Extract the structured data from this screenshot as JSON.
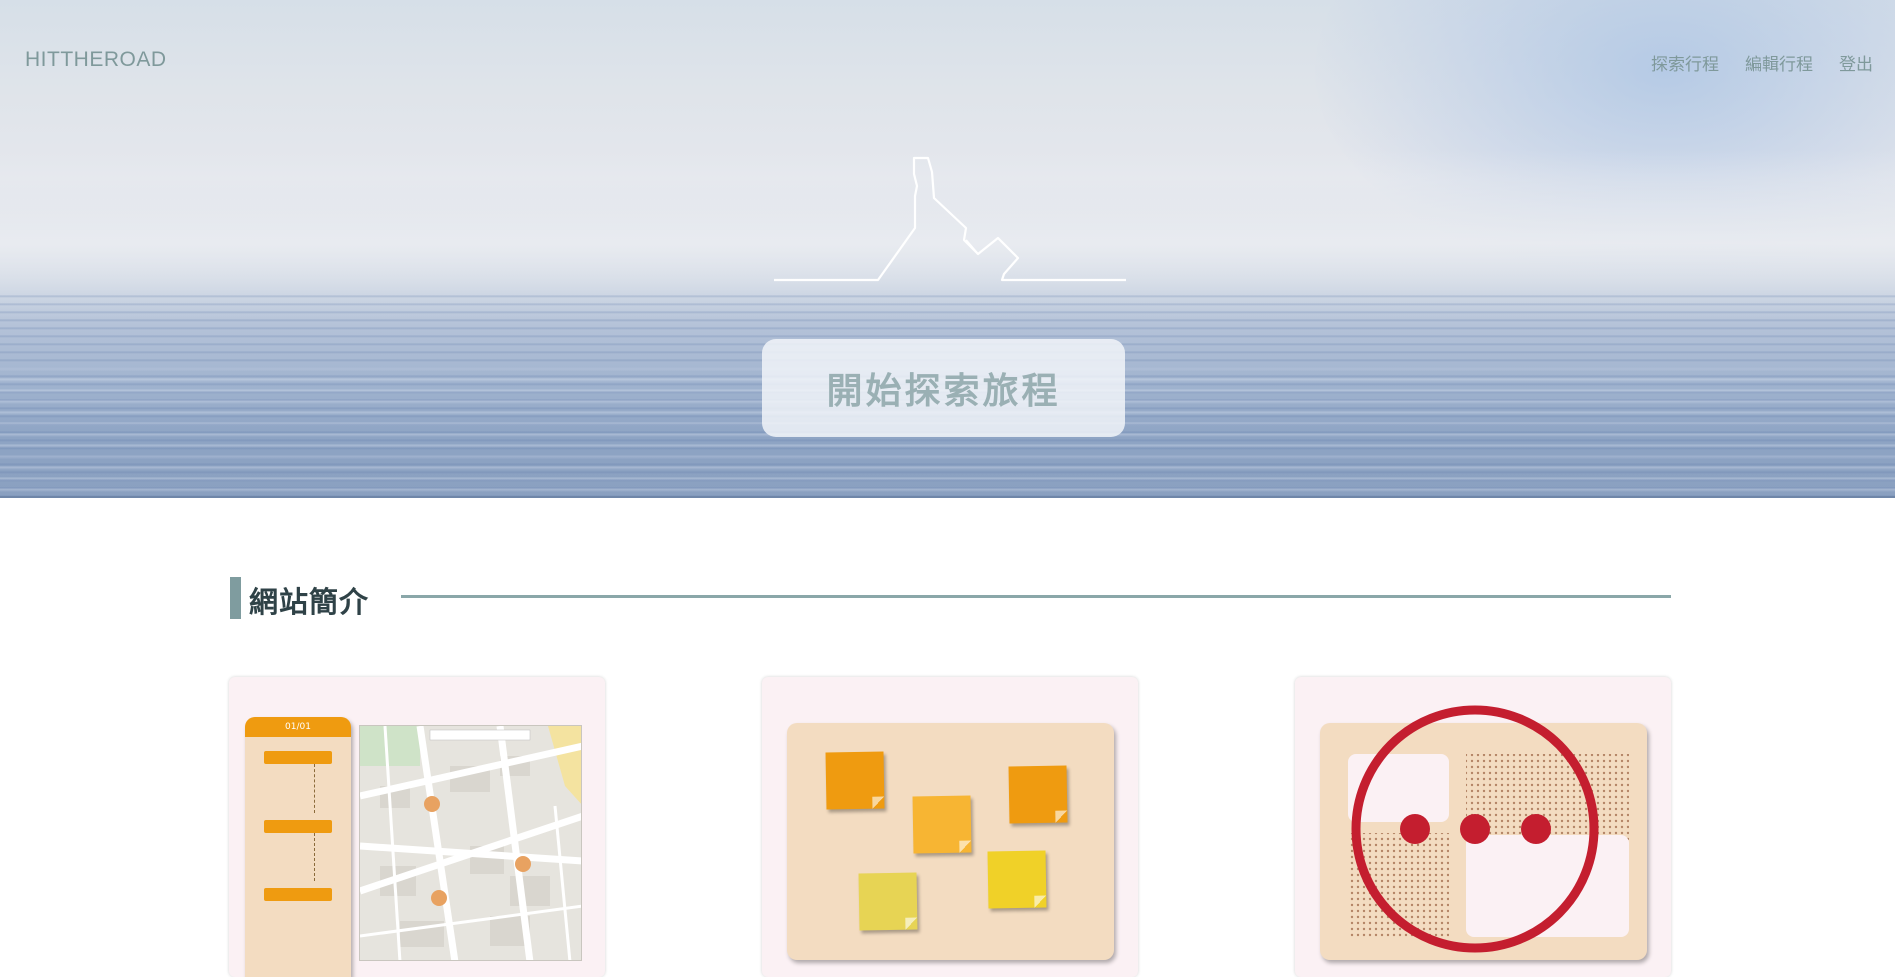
{
  "header": {
    "brand": "HITTHEROAD",
    "nav": [
      "探索行程",
      "編輯行程",
      "登出"
    ]
  },
  "hero": {
    "cta_label": "開始探索旅程"
  },
  "intro": {
    "title": "網站簡介"
  },
  "cards": {
    "card1": {
      "phone_header": "01/01"
    }
  },
  "colors": {
    "accent": "#7f999b",
    "orange": "#ef9b10",
    "panel": "#f3dcc1",
    "card_bg": "#fbf1f4",
    "more_icon": "#c41e2f"
  }
}
